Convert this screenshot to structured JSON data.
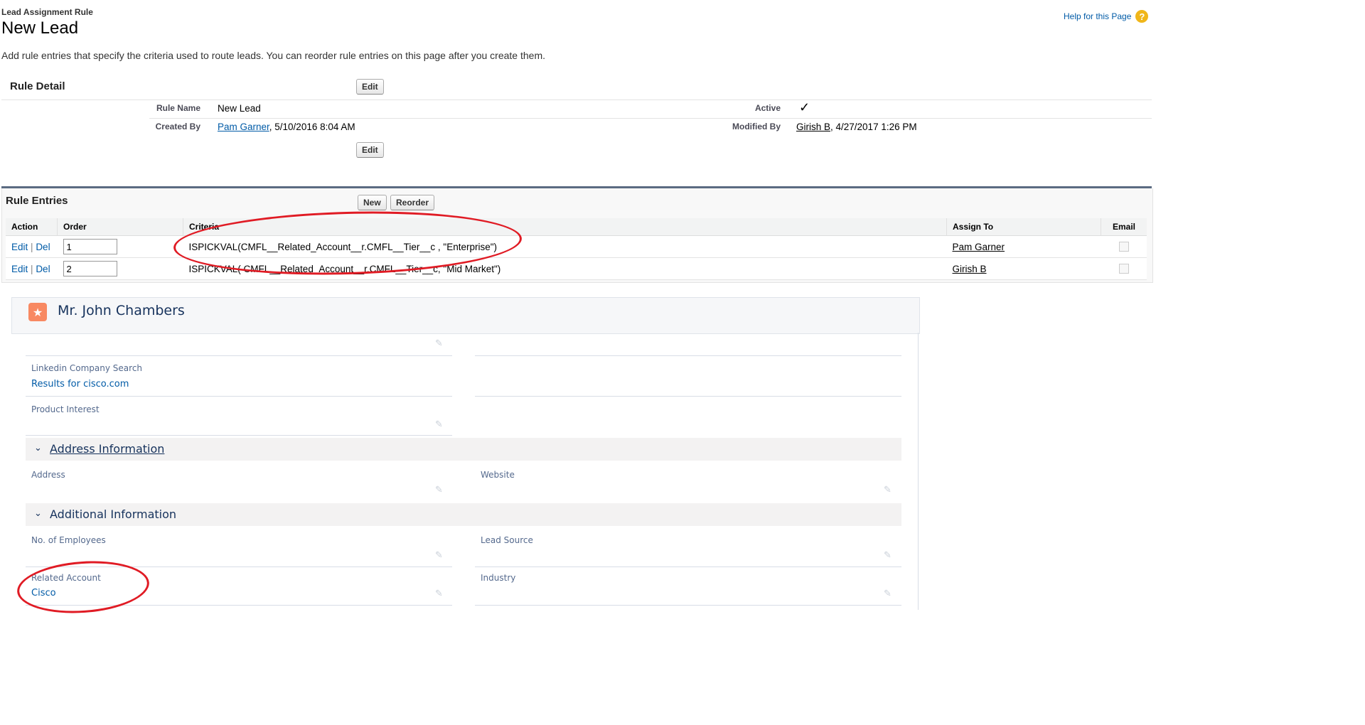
{
  "header": {
    "subtitle": "Lead Assignment Rule",
    "title": "New Lead",
    "help_link": "Help for this Page",
    "description": "Add rule entries that specify the criteria used to route leads. You can reorder rule entries on this page after you create them."
  },
  "rule_detail": {
    "section_title": "Rule Detail",
    "edit_label": "Edit",
    "rule_name_label": "Rule Name",
    "rule_name": "New Lead",
    "active_label": "Active",
    "active_check": "✓",
    "created_by_label": "Created By",
    "created_by_user": "Pam Garner",
    "created_by_date": ", 5/10/2016 8:04 AM",
    "modified_by_label": "Modified By",
    "modified_by_user": "Girish B",
    "modified_by_date": ", 4/27/2017 1:26 PM"
  },
  "rule_entries": {
    "section_title": "Rule Entries",
    "new_label": "New",
    "reorder_label": "Reorder",
    "columns": [
      "Action",
      "Order",
      "Criteria",
      "Assign To",
      "Email"
    ],
    "edit_label": "Edit",
    "del_label": "Del",
    "separator": "|",
    "rows": [
      {
        "order": "1",
        "criteria": "ISPICKVAL(CMFL__Related_Account__r.CMFL__Tier__c , \"Enterprise\")",
        "assign_to": "Pam Garner"
      },
      {
        "order": "2",
        "criteria": "ISPICKVAL( CMFL__Related_Account__r.CMFL__Tier__c, \"Mid Market\")",
        "assign_to": "Girish B"
      }
    ]
  },
  "lead_record": {
    "name": "Mr. John Chambers",
    "icon": "lead-star-icon",
    "linkedin_label": "Linkedin Company Search",
    "linkedin_value": "Results for cisco.com",
    "product_interest_label": "Product Interest",
    "address_section": "Address Information",
    "address_label": "Address",
    "website_label": "Website",
    "additional_section": "Additional Information",
    "employees_label": "No. of Employees",
    "lead_source_label": "Lead Source",
    "related_account_label": "Related Account",
    "related_account_value": "Cisco",
    "industry_label": "Industry"
  },
  "colors": {
    "link": "#015ba7",
    "annotation": "#e01b24",
    "lead_icon": "#f88962",
    "section_heading": "#16325c"
  }
}
